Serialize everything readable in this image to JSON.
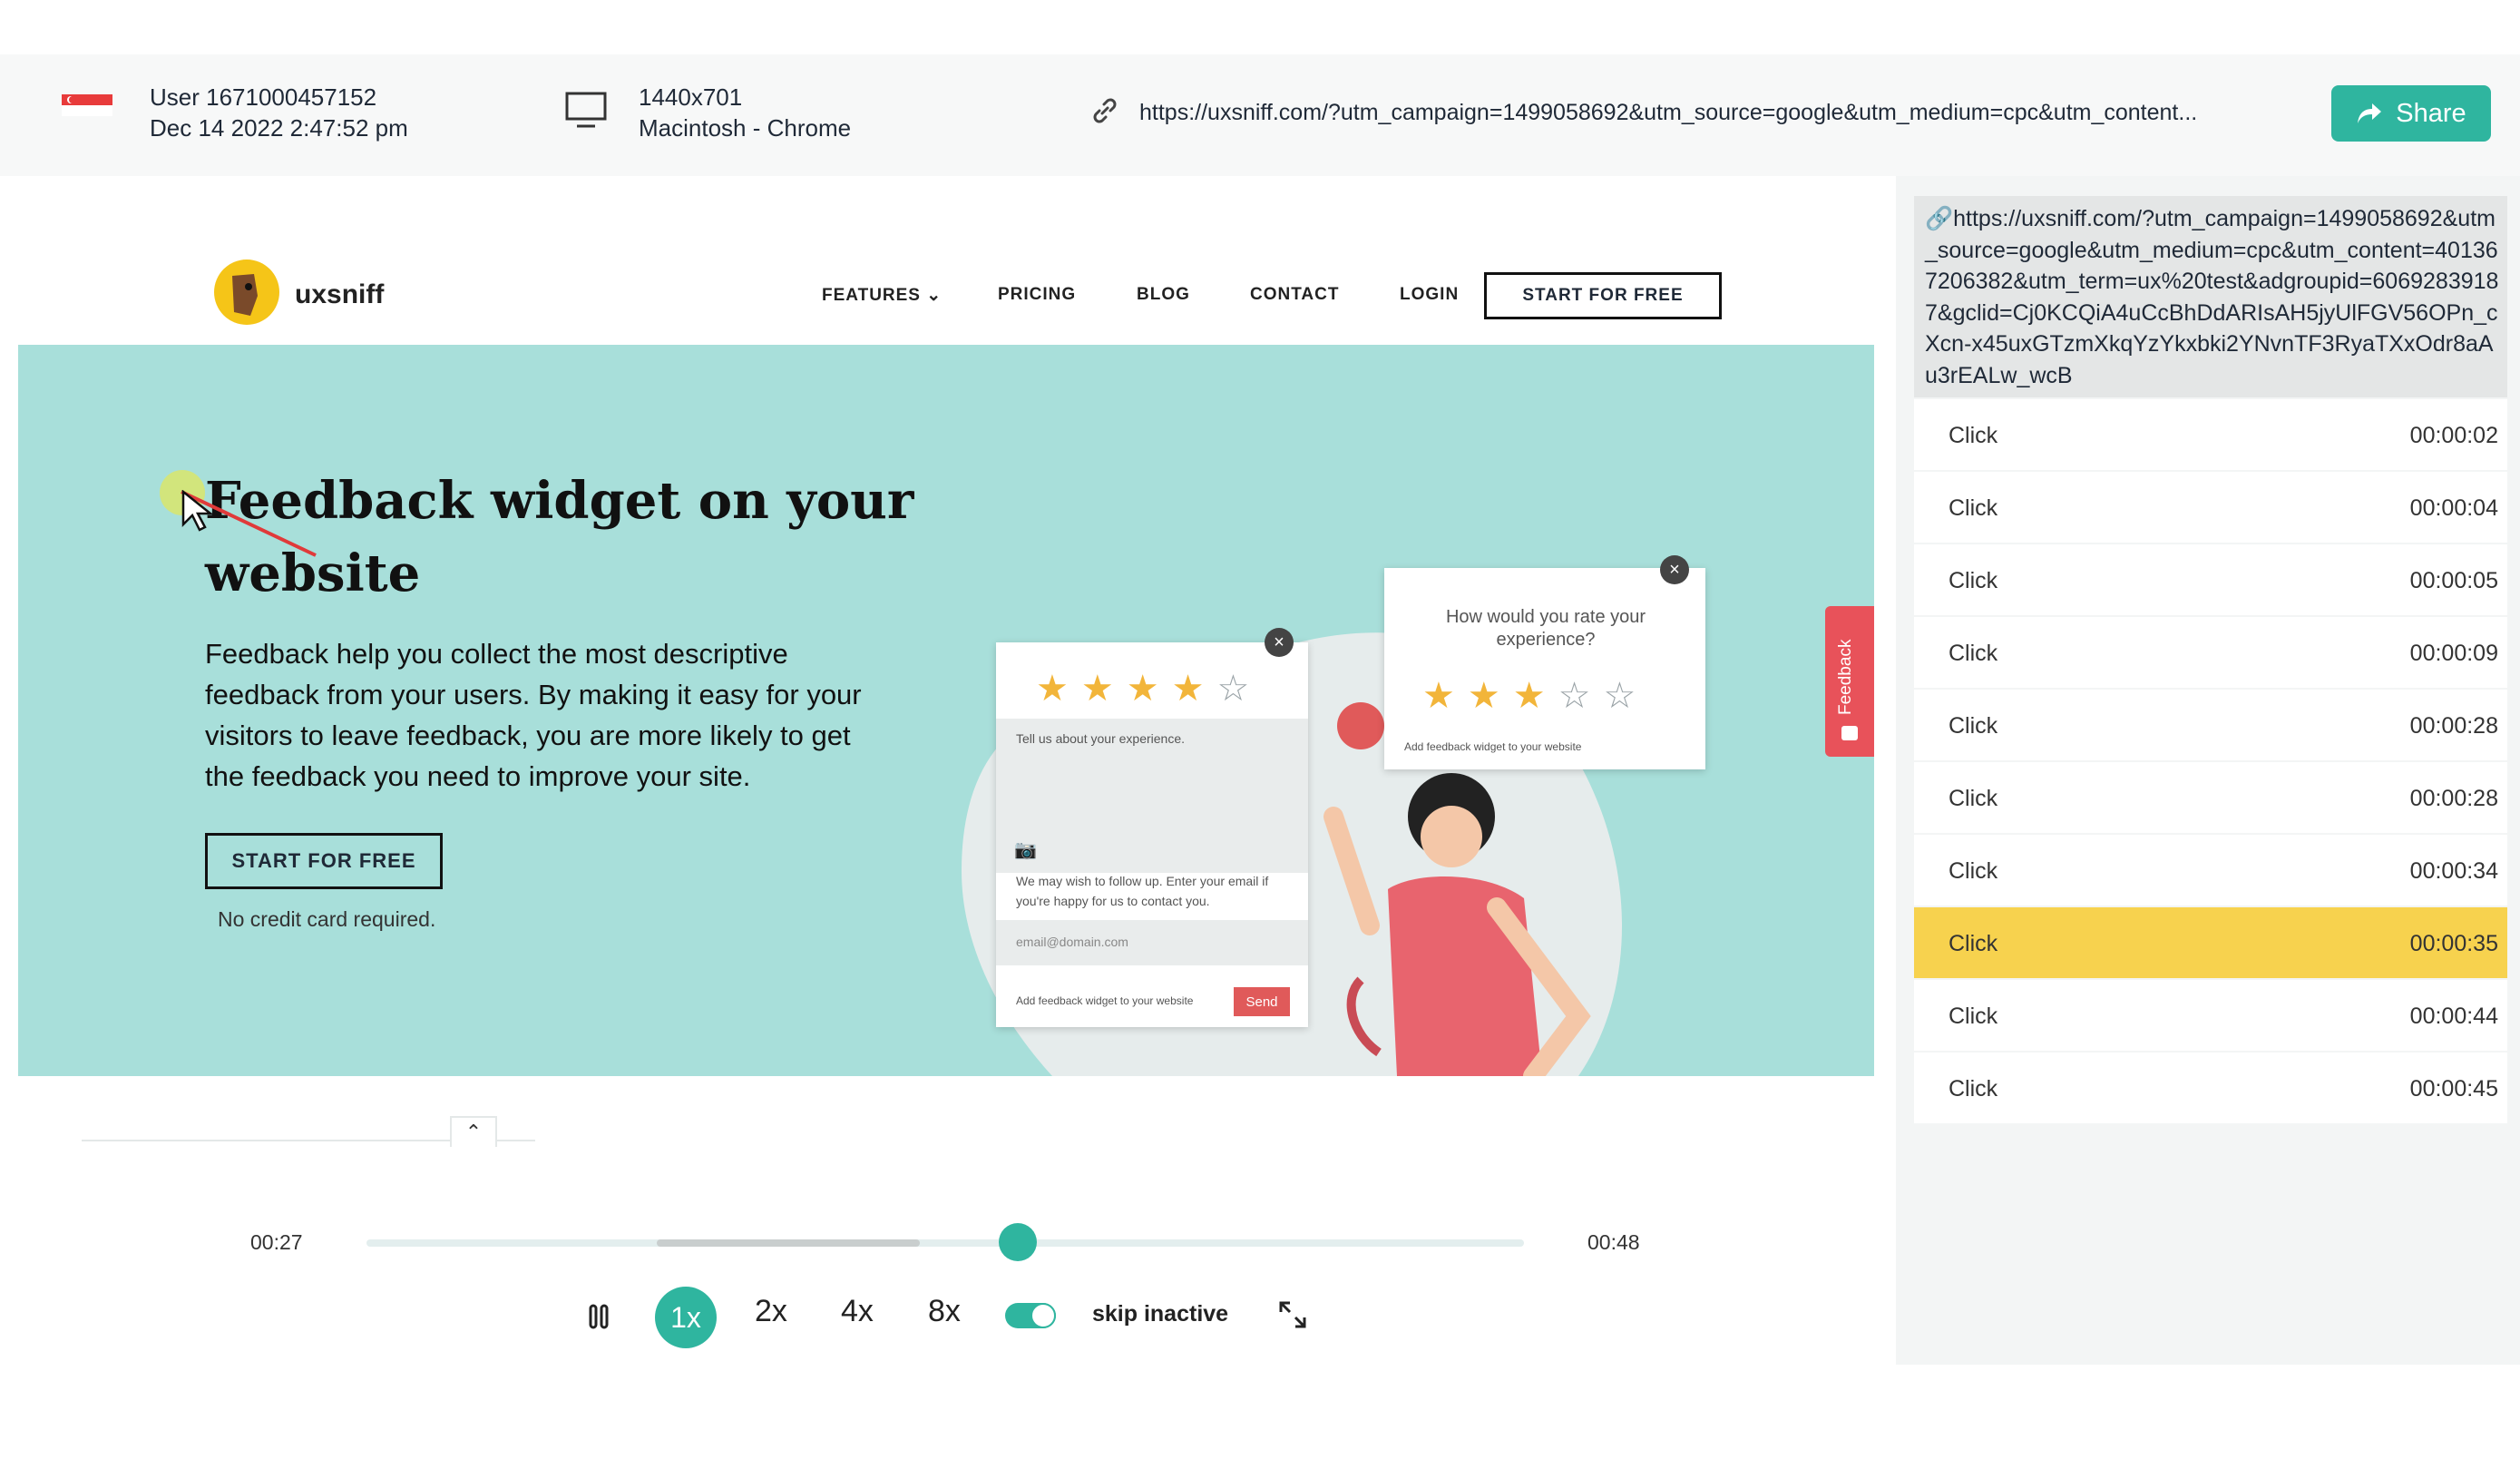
{
  "session": {
    "user": "User 1671000457152",
    "date": "Dec 14 2022 2:47:52 pm",
    "resolution": "1440x701",
    "device": "Macintosh - Chrome",
    "url_short": "https://uxsniff.com/?utm_campaign=1499058692&utm_source=google&utm_medium=cpc&utm_content...",
    "share_label": "Share",
    "flag_icon": "singapore-flag-icon"
  },
  "site": {
    "logo": "uxsniff",
    "nav": [
      "FEATURES",
      "PRICING",
      "BLOG",
      "CONTACT",
      "LOGIN"
    ],
    "nav_cta": "START FOR FREE",
    "hero_title": "Feedback widget on your website",
    "hero_sub": "Feedback help you collect the most descriptive feedback from your users. By making it easy for your visitors to leave feedback, you are more likely to get the feedback you need to improve your site.",
    "hero_cta": "START FOR FREE",
    "hero_note": "No credit card required.",
    "feedback_tab": "Feedback"
  },
  "widget": {
    "card1_placeholder": "Tell us about your experience.",
    "card1_follow": "We may wish to follow up. Enter your email if you're happy for us to contact you.",
    "card1_email": "email@domain.com",
    "card1_footer": "Add feedback widget to your website",
    "card1_send": "Send",
    "card1_rating": 4,
    "card2_question": "How would you rate your experience?",
    "card2_footer": "Add feedback widget to your website",
    "card2_rating": 3
  },
  "player": {
    "current_time": "00:27",
    "total_time": "00:48",
    "speeds": [
      "1x",
      "2x",
      "4x",
      "8x"
    ],
    "active_speed": "1x",
    "skip_inactive_label": "skip inactive",
    "skip_inactive_on": true,
    "progress": 0.5625
  },
  "sidebar": {
    "full_url": "https://uxsniff.com/?utm_campaign=1499058692&utm_source=google&utm_medium=cpc&utm_content=401367206382&utm_term=ux%20test&adgroupid=60692839187&gclid=Cj0KCQiA4uCcBhDdARIsAH5jyUlFGV56OPn_cXcn-x45uxGTzmXkqYzYkxbki2YNvnTF3RyaTXxOdr8aAu3rEALw_wcB",
    "events": [
      {
        "name": "Click",
        "time": "00:00:02"
      },
      {
        "name": "Click",
        "time": "00:00:04"
      },
      {
        "name": "Click",
        "time": "00:00:05"
      },
      {
        "name": "Click",
        "time": "00:00:09"
      },
      {
        "name": "Click",
        "time": "00:00:28"
      },
      {
        "name": "Click",
        "time": "00:00:28"
      },
      {
        "name": "Click",
        "time": "00:00:34"
      },
      {
        "name": "Click",
        "time": "00:00:35"
      },
      {
        "name": "Click",
        "time": "00:00:44"
      },
      {
        "name": "Click",
        "time": "00:00:45"
      }
    ],
    "active_index": 7
  },
  "colors": {
    "accent": "#2fb59f",
    "hero_bg": "#a8dfda",
    "highlight": "#f7d24e",
    "feedback_tab": "#e8525a"
  }
}
